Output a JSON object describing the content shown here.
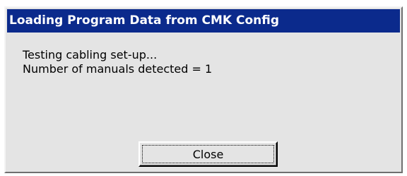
{
  "dialog": {
    "title": "Loading Program Data from CMK Config",
    "messages": [
      "Testing cabling set-up...",
      "Number of manuals detected = 1"
    ],
    "close_label": "Close"
  },
  "colors": {
    "titlebar": "#0b2a8c",
    "dialog_bg": "#e4e4e4",
    "text": "#000000"
  }
}
